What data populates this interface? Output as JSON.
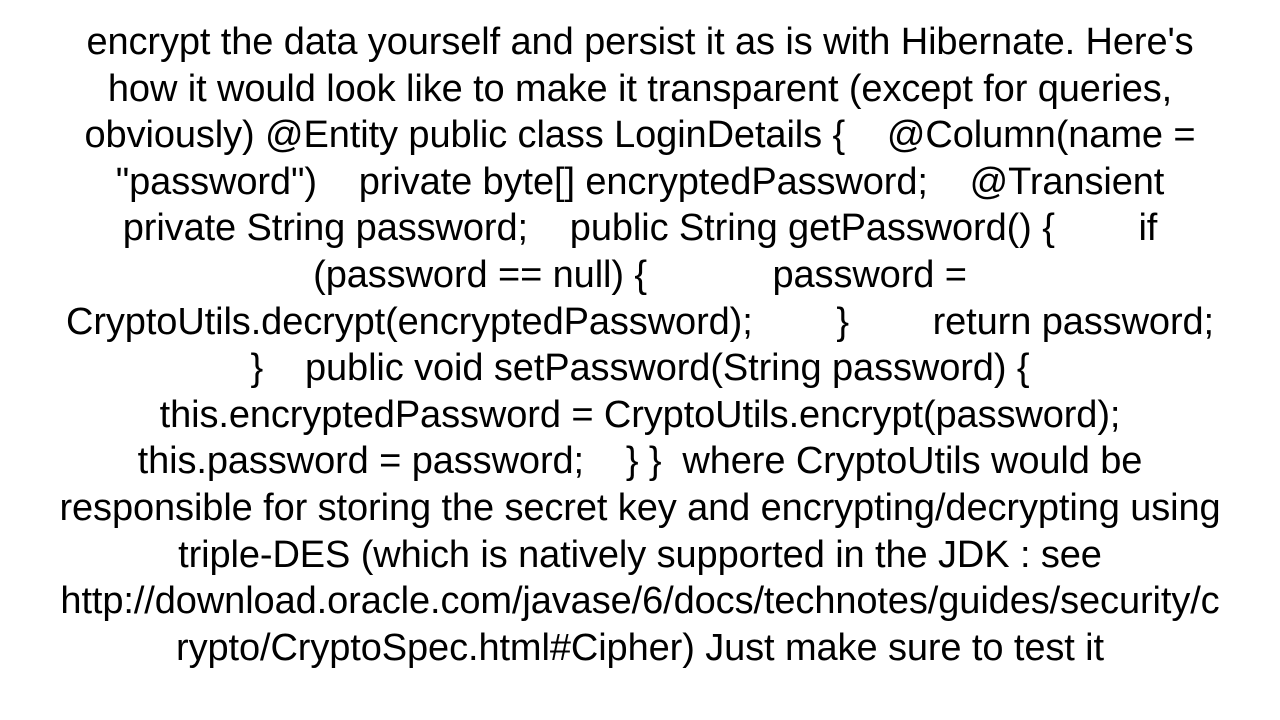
{
  "document": {
    "background_color": "#ffffff",
    "text_color": "#000000",
    "alignment": "center",
    "font_size_px": 38,
    "line_height_px": 46.6,
    "visible_line_count": 16,
    "first_line_clipped": true,
    "last_line_clipped": true,
    "body": "encrypt the data yourself and persist it as is with Hibernate. Here's how it would look like to make it transparent (except for queries, obviously) @Entity public class LoginDetails {    @Column(name = \"password\")    private byte[] encryptedPassword;    @Transient private String password;    public String getPassword() {        if (password == null) {            password = CryptoUtils.decrypt(encryptedPassword);        }        return password;    }    public void setPassword(String password) {        this.encryptedPassword = CryptoUtils.encrypt(password);        this.password = password;    } }  where CryptoUtils would be responsible for storing the secret key and encrypting/decrypting using triple-DES (which is natively supported in the JDK : see http://download.oracle.com/javase/6/docs/technotes/guides/security/crypto/CryptoSpec.html#Cipher) Just make sure to test it",
    "visible_lines": [
      "encrypt the data yourself and persist it as is with",
      "Hibernate. Here's how it would look like to make it",
      "transparent (except for queries, obviously) @Entity public",
      "class LoginDetails {    @Column(name = \"password\")",
      "private byte[] encryptedPassword;    @Transient",
      "private String password;    public String getPassword() {",
      "if (password == null) {        password =",
      "CryptoUtils.decrypt(encryptedPassword);      }",
      "return password;    }    public void setPassword(String",
      "password) {       this.encryptedPassword =",
      "CryptoUtils.encrypt(password);       this.password =",
      "password;    } }  where CryptoUtils would be responsible",
      "for storing the secret key and encrypting/decrypting using",
      "triple-DES (which is natively supported in the JDK : see htt",
      "p://download.oracle.com/javase/6/docs/technotes/guides/secur",
      "ity/crypto/CryptoSpec.html#Cipher) Just make sure to test it"
    ]
  }
}
